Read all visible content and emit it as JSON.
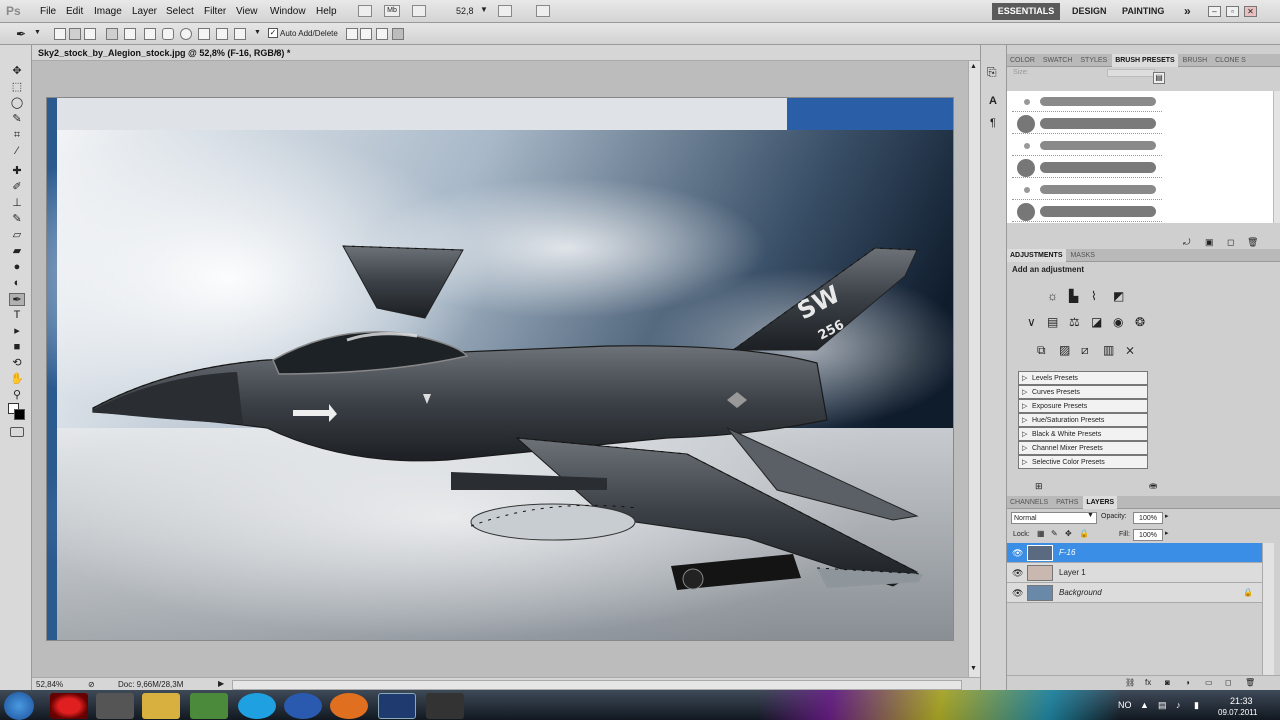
{
  "app": {
    "logo": "Ps"
  },
  "menu": [
    "File",
    "Edit",
    "Image",
    "Layer",
    "Select",
    "Filter",
    "View",
    "Window",
    "Help"
  ],
  "menubar_extra": {
    "mb_label": "Mb",
    "zoom_value": "52,8"
  },
  "workspaces": {
    "essentials": "ESSENTIALS",
    "design": "DESIGN",
    "painting": "PAINTING",
    "more": "»"
  },
  "window_controls": {
    "minimize": "–",
    "restore": "▫",
    "close": "✕"
  },
  "options_bar": {
    "auto_add_delete_label": "Auto Add/Delete",
    "auto_add_delete_checked": true
  },
  "document": {
    "tab_title": "Sky2_stock_by_Alegion_stock.jpg @ 52,8% (F-16, RGB/8) *",
    "close": "×",
    "zoom": "52,84%",
    "doc_info": "Doc: 9,66M/28,3M"
  },
  "panels": {
    "brush_tabs": [
      "COLOR",
      "SWATCH",
      "STYLES",
      "BRUSH PRESETS",
      "BRUSH",
      "CLONE S"
    ],
    "brush_size_label": "Size:",
    "adjustments_tabs": [
      "ADJUSTMENTS",
      "MASKS"
    ],
    "adjustments_heading": "Add an adjustment",
    "presets": [
      "Levels Presets",
      "Curves Presets",
      "Exposure Presets",
      "Hue/Saturation Presets",
      "Black & White Presets",
      "Channel Mixer Presets",
      "Selective Color Presets"
    ],
    "layers_tabs": [
      "CHANNELS",
      "PATHS",
      "LAYERS"
    ],
    "blend_mode": "Normal",
    "opacity_label": "Opacity:",
    "opacity_value": "100%",
    "lock_label": "Lock:",
    "fill_label": "Fill:",
    "fill_value": "100%",
    "layers": [
      {
        "name": "F-16",
        "selected": true,
        "locked": false
      },
      {
        "name": "Layer 1",
        "selected": false,
        "locked": false
      },
      {
        "name": "Background",
        "selected": false,
        "locked": true
      }
    ]
  },
  "image_text": {
    "tail_code": "SW",
    "tail_number": "256"
  },
  "taskbar": {
    "lang": "NO",
    "time": "21:33",
    "date": "09.07.2011"
  },
  "colors": {
    "selection_blue": "#3b8ee6",
    "taskbar": "#1b2430"
  }
}
